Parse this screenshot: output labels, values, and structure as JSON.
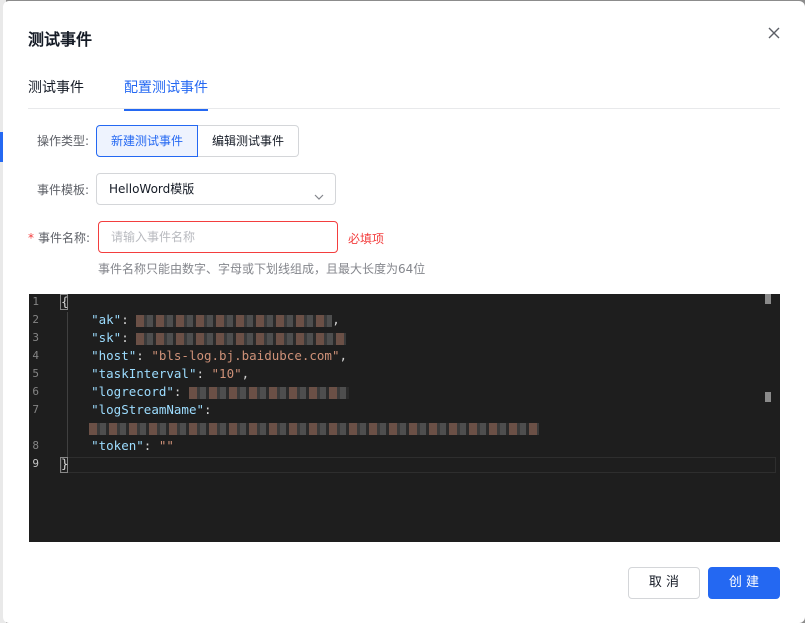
{
  "modal": {
    "title": "测试事件"
  },
  "tabs": [
    {
      "label": "测试事件"
    },
    {
      "label": "配置测试事件"
    }
  ],
  "form": {
    "op_type_label": "操作类型:",
    "op_options": [
      "新建测试事件",
      "编辑测试事件"
    ],
    "template_label": "事件模板:",
    "template_value": "HelloWord模版",
    "name_required_mark": "*",
    "name_label": "事件名称:",
    "name_placeholder": "请输入事件名称",
    "name_error": "必填项",
    "name_hint": "事件名称只能由数字、字母或下划线组成，且最大长度为64位"
  },
  "editor": {
    "line_numbers": [
      "1",
      "2",
      "3",
      "4",
      "5",
      "6",
      "7",
      "",
      "8",
      "9"
    ],
    "open_brace": "{",
    "close_brace": "}",
    "key_ak": "\"ak\"",
    "key_sk": "\"sk\"",
    "key_host": "\"host\"",
    "host_value": "\"bls-log.bj.baidubce.com\"",
    "key_task_interval": "\"taskInterval\"",
    "task_interval_value": "\"10\"",
    "key_logrecord": "\"logrecord\"",
    "key_log_stream_name": "\"logStreamName\"",
    "key_token": "\"token\"",
    "token_value": "\"\""
  },
  "footer": {
    "cancel_label": "取 消",
    "create_label": "创 建"
  },
  "colors": {
    "primary": "#2468f2",
    "error": "#f33e3e",
    "editor_bg": "#1e1e1e"
  }
}
